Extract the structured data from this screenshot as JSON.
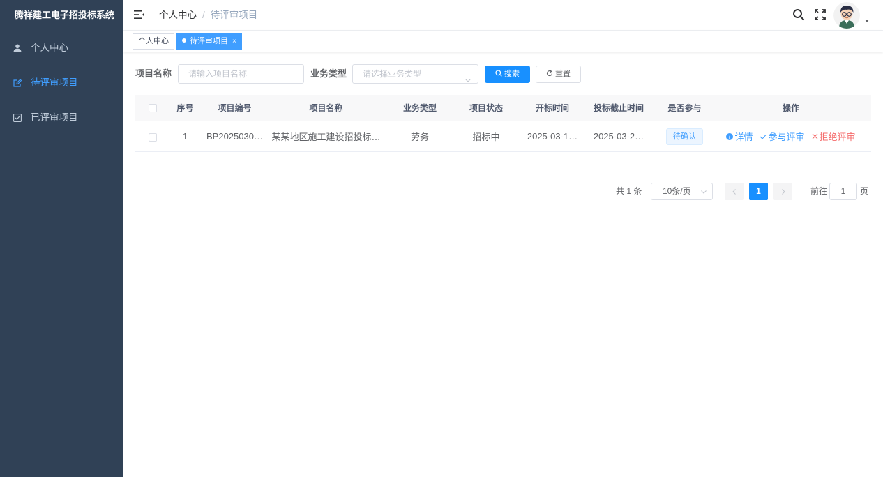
{
  "sidebar": {
    "logo": "腾祥建工电子招投标系统",
    "items": [
      {
        "label": "个人中心",
        "icon": "user-icon",
        "active": false
      },
      {
        "label": "待评审项目",
        "icon": "edit-icon",
        "active": true
      },
      {
        "label": "已评审项目",
        "icon": "checkbox-icon",
        "active": false
      }
    ]
  },
  "navbar": {
    "breadcrumb": [
      "个人中心",
      "待评审项目"
    ],
    "separator": "/"
  },
  "tags": [
    {
      "label": "个人中心",
      "active": false
    },
    {
      "label": "待评审项目",
      "active": true,
      "close": "×"
    }
  ],
  "search": {
    "name_label": "项目名称",
    "name_placeholder": "请输入项目名称",
    "type_label": "业务类型",
    "type_placeholder": "请选择业务类型",
    "search_button": "搜索",
    "reset_button": "重置"
  },
  "table": {
    "headers": [
      "序号",
      "项目编号",
      "项目名称",
      "业务类型",
      "项目状态",
      "开标时间",
      "投标截止时间",
      "是否参与",
      "操作"
    ],
    "rows": [
      {
        "index": "1",
        "code": "BP2025030…",
        "name": "某某地区施工建设招投标…",
        "type": "劳务",
        "status": "招标中",
        "open_time": "2025-03-1…",
        "deadline": "2025-03-2…",
        "participate": "待确认",
        "actions": {
          "detail": "详情",
          "join": "参与评审",
          "reject": "拒绝评审"
        }
      }
    ]
  },
  "pagination": {
    "total": "共 1 条",
    "page_size": "10条/页",
    "current": "1",
    "goto_label": "前往",
    "goto_value": "1",
    "page_suffix": "页"
  },
  "colors": {
    "sidebar_bg": "#304156",
    "primary": "#1890ff",
    "danger": "#f56c6c"
  }
}
